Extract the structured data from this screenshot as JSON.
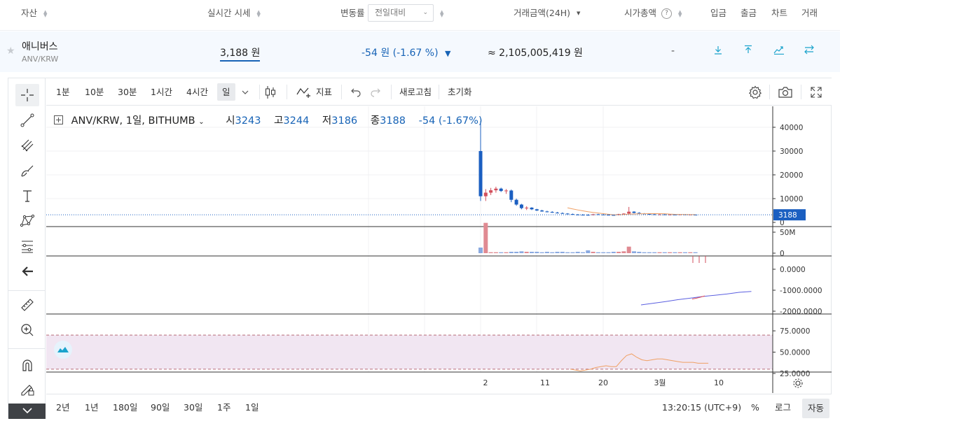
{
  "header": {
    "asset": "자산",
    "price": "실시간 시세",
    "change": "변동률",
    "change_select": "전일대비",
    "volume": "거래금액(24H)",
    "mcap": "시가총액",
    "mcap_help": "?",
    "deposit": "입금",
    "withdraw": "출금",
    "chart": "차트",
    "trade": "거래"
  },
  "asset_row": {
    "name": "애니버스",
    "symbol": "ANV/KRW",
    "price": "3,188 원",
    "change": "-54 원 (-1.67 %)",
    "change_arrow": "▼",
    "volume": "≈ 2,105,005,419 원",
    "mcap": "-"
  },
  "toolbar": {
    "intervals": [
      "1분",
      "10분",
      "30분",
      "1시간",
      "4시간",
      "일"
    ],
    "active_interval": "일",
    "indicators": "지표",
    "refresh": "새로고침",
    "reset": "초기화"
  },
  "legend": {
    "symbol": "ANV/KRW, 1일, BITHUMB",
    "open_label": "시",
    "open": "3243",
    "high_label": "고",
    "high": "3244",
    "low_label": "저",
    "low": "3186",
    "close_label": "종",
    "close": "3188",
    "change": "-54 (-1.67%)"
  },
  "price_axis": {
    "ticks": [
      "40000",
      "30000",
      "20000",
      "10000",
      "0"
    ],
    "last_price_label": "3188",
    "volume_ticks": [
      "50M",
      "0"
    ],
    "macd_ticks": [
      "0.0000",
      "-1000.0000",
      "-2000.0000"
    ],
    "rsi_ticks": [
      "75.0000",
      "50.0000",
      "25.0000"
    ]
  },
  "time_axis": [
    "2",
    "11",
    "20",
    "3월",
    "10"
  ],
  "bottom_bar": {
    "ranges": [
      "2년",
      "1년",
      "180일",
      "90일",
      "30일",
      "1주",
      "1일"
    ],
    "time": "13:20:15 (UTC+9)",
    "percent": "%",
    "log": "로그",
    "auto": "자동"
  },
  "colors": {
    "up": "#d24f5c",
    "down": "#1b5fc1",
    "accent": "#1763b6",
    "icon_teal": "#1aa3cc",
    "rsi_band": "#f1e6f2",
    "ma_line": "#f0a064",
    "macd_line": "#5b5fe0",
    "signal_line": "#e0505a"
  },
  "chart_data": {
    "type": "candlestick",
    "title": "ANV/KRW, 1일, BITHUMB",
    "ylim": [
      0,
      45000
    ],
    "candles": [
      {
        "o": 30000,
        "h": 42500,
        "l": 9000,
        "c": 11000
      },
      {
        "o": 11000,
        "h": 14000,
        "l": 9000,
        "c": 12500
      },
      {
        "o": 12500,
        "h": 14500,
        "l": 11500,
        "c": 13500
      },
      {
        "o": 13500,
        "h": 15000,
        "l": 12500,
        "c": 14200
      },
      {
        "o": 14200,
        "h": 14600,
        "l": 12800,
        "c": 13200
      },
      {
        "o": 13200,
        "h": 14000,
        "l": 12000,
        "c": 13400
      },
      {
        "o": 13400,
        "h": 13800,
        "l": 8500,
        "c": 9500
      },
      {
        "o": 9500,
        "h": 10000,
        "l": 7000,
        "c": 7500
      },
      {
        "o": 7500,
        "h": 7800,
        "l": 5500,
        "c": 6000
      },
      {
        "o": 6000,
        "h": 6800,
        "l": 5200,
        "c": 6200
      },
      {
        "o": 6200,
        "h": 6400,
        "l": 5200,
        "c": 5500
      },
      {
        "o": 5500,
        "h": 5700,
        "l": 4800,
        "c": 5000
      },
      {
        "o": 5000,
        "h": 5300,
        "l": 4500,
        "c": 4600
      },
      {
        "o": 4600,
        "h": 4900,
        "l": 4200,
        "c": 4400
      },
      {
        "o": 4400,
        "h": 4700,
        "l": 4000,
        "c": 4100
      },
      {
        "o": 4100,
        "h": 4400,
        "l": 3800,
        "c": 3900
      },
      {
        "o": 3900,
        "h": 4200,
        "l": 3600,
        "c": 3700
      },
      {
        "o": 3700,
        "h": 3900,
        "l": 3400,
        "c": 3500
      },
      {
        "o": 3500,
        "h": 3700,
        "l": 3200,
        "c": 3300
      },
      {
        "o": 3300,
        "h": 3500,
        "l": 3100,
        "c": 3200
      },
      {
        "o": 3200,
        "h": 3500,
        "l": 3000,
        "c": 3150
      },
      {
        "o": 3150,
        "h": 3400,
        "l": 3000,
        "c": 3100
      },
      {
        "o": 3100,
        "h": 3600,
        "l": 2900,
        "c": 3400
      },
      {
        "o": 3400,
        "h": 3600,
        "l": 3200,
        "c": 3300
      },
      {
        "o": 3300,
        "h": 3500,
        "l": 3100,
        "c": 3200
      },
      {
        "o": 3200,
        "h": 3400,
        "l": 3000,
        "c": 3100
      },
      {
        "o": 3100,
        "h": 3300,
        "l": 2900,
        "c": 3050
      },
      {
        "o": 3050,
        "h": 3600,
        "l": 3000,
        "c": 3500
      },
      {
        "o": 3500,
        "h": 3800,
        "l": 3300,
        "c": 3700
      },
      {
        "o": 3700,
        "h": 6500,
        "l": 3400,
        "c": 4500
      },
      {
        "o": 4500,
        "h": 4700,
        "l": 3800,
        "c": 4000
      },
      {
        "o": 4000,
        "h": 4300,
        "l": 3600,
        "c": 3700
      },
      {
        "o": 3700,
        "h": 3900,
        "l": 3400,
        "c": 3500
      },
      {
        "o": 3500,
        "h": 3800,
        "l": 3300,
        "c": 3400
      },
      {
        "o": 3400,
        "h": 3600,
        "l": 3200,
        "c": 3300
      },
      {
        "o": 3300,
        "h": 3500,
        "l": 3100,
        "c": 3350
      },
      {
        "o": 3350,
        "h": 3500,
        "l": 3200,
        "c": 3250
      },
      {
        "o": 3250,
        "h": 3400,
        "l": 3100,
        "c": 3300
      },
      {
        "o": 3300,
        "h": 3500,
        "l": 3150,
        "c": 3200
      },
      {
        "o": 3200,
        "h": 3400,
        "l": 3100,
        "c": 3350
      },
      {
        "o": 3350,
        "h": 3450,
        "l": 3150,
        "c": 3250
      },
      {
        "o": 3250,
        "h": 3350,
        "l": 3100,
        "c": 3300
      },
      {
        "o": 3243,
        "h": 3244,
        "l": 3186,
        "c": 3188
      }
    ],
    "volume_m": [
      12,
      65,
      2,
      2,
      2,
      2,
      3,
      3,
      4,
      3,
      3,
      3,
      2,
      3,
      2,
      3,
      3,
      2,
      2,
      3,
      2,
      6,
      3,
      2,
      2,
      2,
      3,
      3,
      4,
      14,
      4,
      3,
      2,
      2,
      2,
      2,
      2,
      2,
      2,
      2,
      2,
      2,
      2
    ],
    "macd_line": [
      -1700,
      -1620,
      -1540,
      -1450,
      -1380,
      -1300,
      -1240,
      -1180,
      -1100,
      -1060
    ],
    "macd_signal": [
      -1420,
      -1380,
      -1330,
      -1270
    ],
    "rsi": [
      30,
      29,
      28,
      29,
      30,
      32,
      33,
      34,
      33,
      33,
      40,
      46,
      48,
      44,
      41,
      40,
      41,
      42,
      42,
      41,
      40,
      39,
      38,
      38,
      38,
      37,
      37,
      37
    ],
    "rsi_bands": [
      70,
      30
    ]
  }
}
